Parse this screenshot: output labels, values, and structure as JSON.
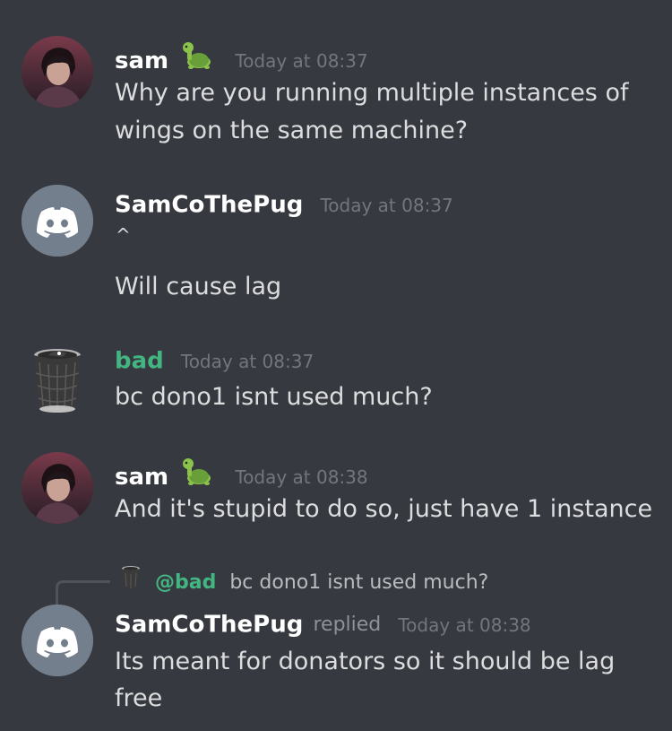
{
  "messages": [
    {
      "author": "sam",
      "badge_icon": "turtle-icon",
      "timestamp": "Today at 08:37",
      "lines": [
        "Why are you running multiple instances of",
        "wings on the same machine?"
      ]
    },
    {
      "author": "SamCoThePug",
      "timestamp": "Today at 08:37",
      "caret": "^",
      "lines": [
        "Will cause lag"
      ]
    },
    {
      "author": "bad",
      "author_color": "#43b581",
      "timestamp": "Today at 08:37",
      "lines": [
        "bc dono1 isnt used much?"
      ]
    },
    {
      "author": "sam",
      "badge_icon": "turtle-icon",
      "timestamp": "Today at 08:38",
      "lines": [
        "And it's stupid to do so, just have 1 instance"
      ]
    },
    {
      "author": "SamCoThePug",
      "replied_label": "replied",
      "timestamp": "Today at 08:38",
      "reply": {
        "mention": "@bad",
        "snippet": "bc dono1 isnt used much?"
      },
      "lines": [
        "Its meant for donators so it should be lag",
        "free"
      ]
    }
  ],
  "colors": {
    "background": "#36393f",
    "text": "#dcddde",
    "timestamp": "#72767d",
    "mention": "#43b581",
    "discord_avatar": "#747f8d"
  }
}
